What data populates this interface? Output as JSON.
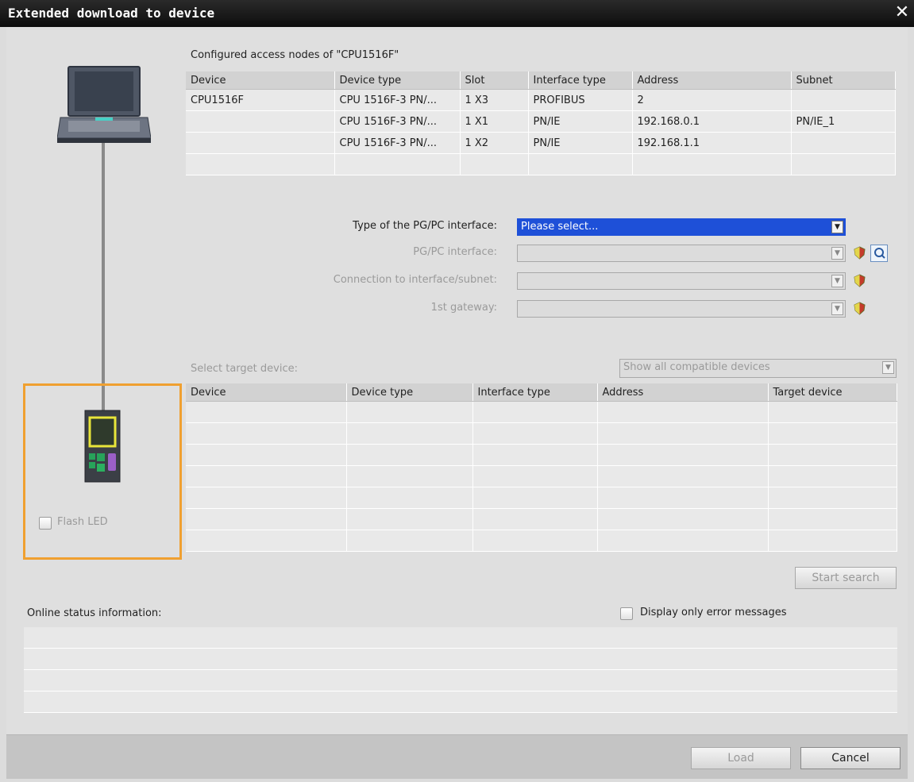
{
  "window": {
    "title": "Extended download to device",
    "close_glyph": "✕"
  },
  "access_nodes": {
    "caption": "Configured access nodes of \"CPU1516F\"",
    "columns": [
      "Device",
      "Device type",
      "Slot",
      "Interface type",
      "Address",
      "Subnet"
    ],
    "rows": [
      [
        "CPU1516F",
        "CPU 1516F-3 PN/...",
        "1 X3",
        "PROFIBUS",
        "2",
        ""
      ],
      [
        "",
        "CPU 1516F-3 PN/...",
        "1 X1",
        "PN/IE",
        "192.168.0.1",
        "PN/IE_1"
      ],
      [
        "",
        "CPU 1516F-3 PN/...",
        "1 X2",
        "PN/IE",
        "192.168.1.1",
        ""
      ],
      [
        "",
        "",
        "",
        "",
        "",
        ""
      ]
    ]
  },
  "interface": {
    "type_label": "Type of the PG/PC interface:",
    "type_value": "Please select...",
    "pgpc_label": "PG/PC interface:",
    "pgpc_value": "",
    "connection_label": "Connection to interface/subnet:",
    "connection_value": "",
    "gateway_label": "1st gateway:",
    "gateway_value": ""
  },
  "target": {
    "label": "Select target device:",
    "filter_value": "Show all compatible devices",
    "columns": [
      "Device",
      "Device type",
      "Interface type",
      "Address",
      "Target device"
    ],
    "empty_rows": 7
  },
  "flash_led": {
    "label": "Flash LED",
    "checked": false
  },
  "start_search_label": "Start search",
  "online_status": {
    "label": "Online status information:",
    "error_only_label": "Display only error messages",
    "error_only_checked": false,
    "rows": [
      "",
      "",
      "",
      ""
    ]
  },
  "buttons": {
    "load_label": "Load",
    "cancel_label": "Cancel"
  },
  "colors": {
    "accent_select": "#1e50d8",
    "highlight_frame": "#f0a030",
    "cable": "#8a8a8a"
  }
}
